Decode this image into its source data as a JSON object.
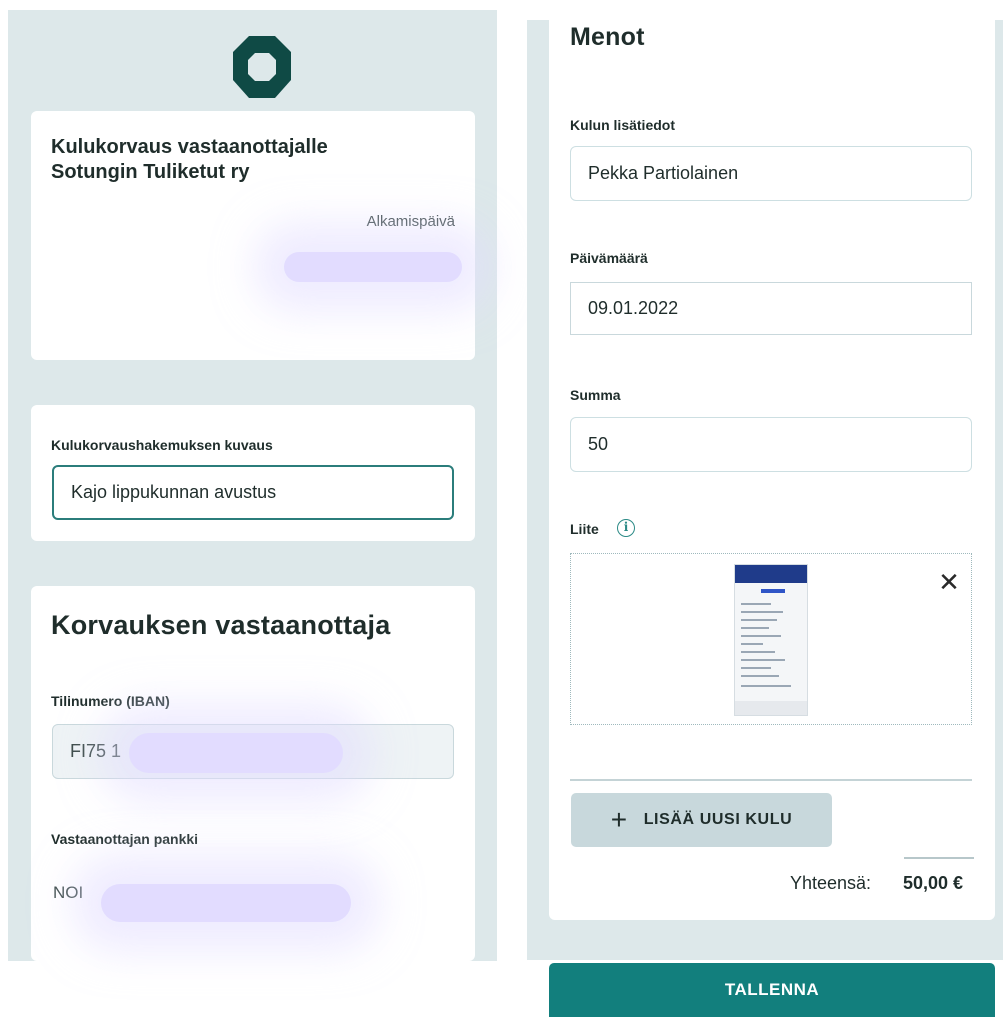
{
  "left": {
    "header_card": {
      "title": "Kulukorvaus vastaanottajalle Sotungin Tuliketut ry",
      "start_date_label": "Alkamispäivä"
    },
    "description_card": {
      "label": "Kulukorvaushakemuksen kuvaus",
      "value": "Kajo lippukunnan avustus"
    },
    "recipient_card": {
      "heading": "Korvauksen vastaanottaja",
      "iban_label": "Tilinumero (IBAN)",
      "iban_value": "FI75 1",
      "bank_label": "Vastaanottajan pankki",
      "bank_value": "NOI"
    }
  },
  "right": {
    "heading": "Menot",
    "details_label": "Kulun lisätiedot",
    "details_value": "Pekka Partiolainen",
    "date_label": "Päivämäärä",
    "date_value": "09.01.2022",
    "amount_label": "Summa",
    "amount_value": "50",
    "attachment_label": "Liite",
    "info_glyph": "i",
    "remove_glyph": "✕",
    "add_plus": "+",
    "add_button": "LISÄÄ UUSI KULU",
    "total_label": "Yhteensä:",
    "total_value": "50,00 €",
    "save_button": "TALLENNA"
  },
  "colors": {
    "accent": "#127f7d",
    "panel_bg": "#dde8ea",
    "logo": "#0f4a45"
  },
  "icons": [
    "logo-icon",
    "info-icon",
    "close-icon",
    "plus-icon"
  ]
}
